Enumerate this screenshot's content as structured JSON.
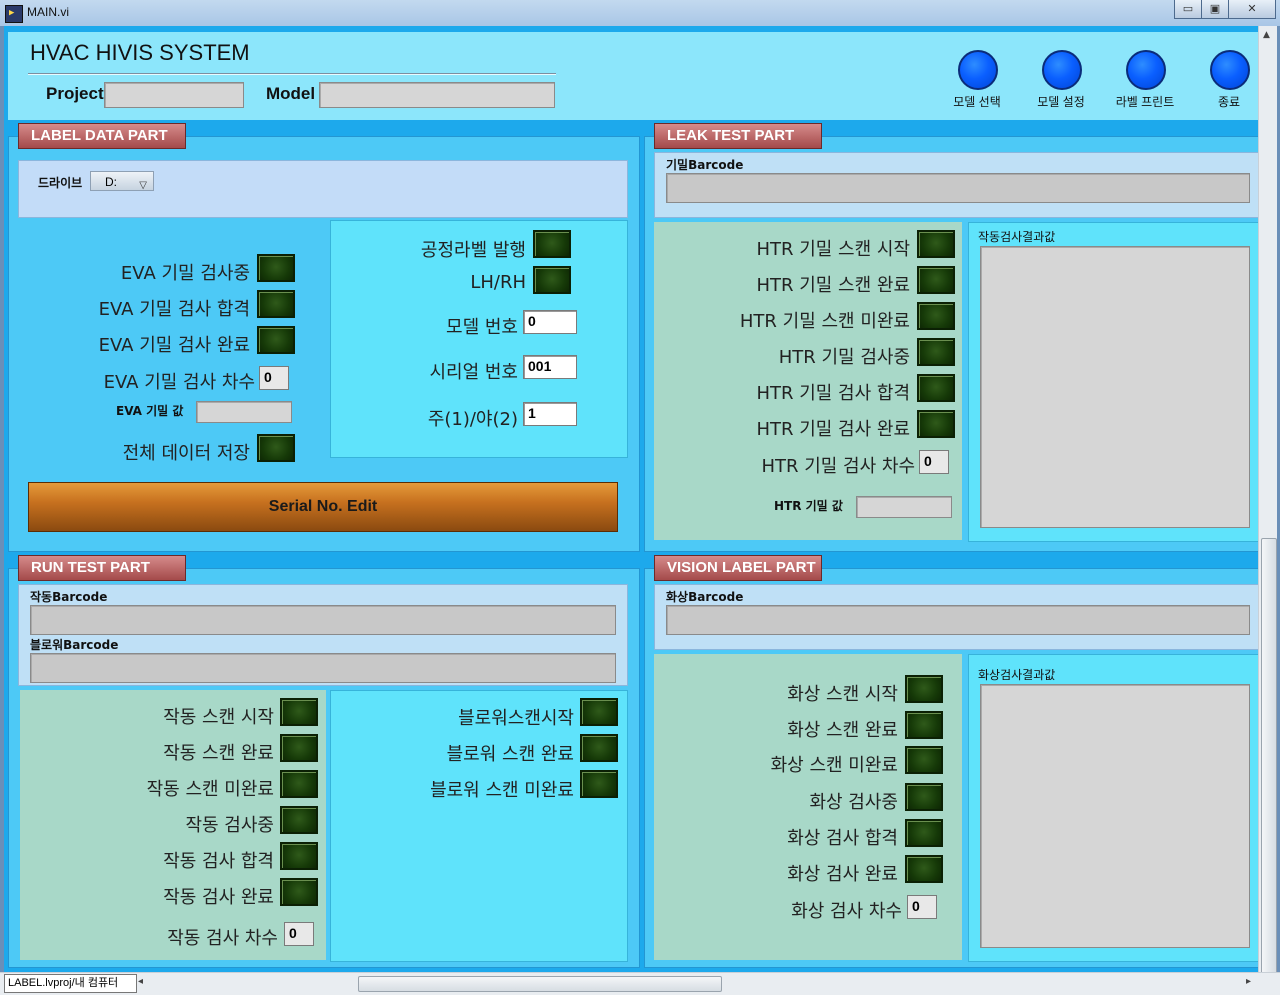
{
  "window": {
    "title": "MAIN.vi",
    "controls": {
      "minimize": "▭",
      "restore": "▣",
      "close": "✕"
    }
  },
  "header": {
    "system_name": "HVAC HIVIS SYSTEM",
    "project_label": "Project",
    "project_value": "",
    "model_label": "Model",
    "model_value": "",
    "buttons": [
      {
        "label": "모델 선택"
      },
      {
        "label": "모델 설정"
      },
      {
        "label": "라벨 프린트"
      },
      {
        "label": "종료"
      }
    ]
  },
  "label_data": {
    "tab": "LABEL DATA PART",
    "drive_label": "드라이브",
    "drive_value": "D:",
    "left_indicators": [
      {
        "label": "EVA 기밀 검사중"
      },
      {
        "label": "EVA 기밀 검사 합격"
      },
      {
        "label": "EVA 기밀 검사 완료"
      }
    ],
    "eva_count_label": "EVA 기밀 검사 차수",
    "eva_count_value": "0",
    "eva_value_label": "EVA 기밀 값",
    "eva_value": "",
    "save_all_label": "전체 데이터 저장",
    "right": {
      "process_label": "공정라벨 발행",
      "lhrh_label": "LH/RH",
      "model_no_label": "모델 번호",
      "model_no_value": "0",
      "serial_no_label": "시리얼 번호",
      "serial_no_value": "001",
      "daynight_label": "주(1)/야(2)",
      "daynight_value": "1"
    },
    "serial_edit_button": "Serial No. Edit"
  },
  "leak_test": {
    "tab": "LEAK TEST PART",
    "barcode_label": "기밀Barcode",
    "barcode_value": "",
    "indicators": [
      {
        "label": "HTR 기밀 스캔 시작"
      },
      {
        "label": "HTR 기밀 스캔 완료"
      },
      {
        "label": "HTR 기밀 스캔 미완료"
      },
      {
        "label": "HTR 기밀 검사중"
      },
      {
        "label": "HTR 기밀 검사 합격"
      },
      {
        "label": "HTR 기밀 검사 완료"
      }
    ],
    "count_label": "HTR 기밀 검사 차수",
    "count_value": "0",
    "value_label": "HTR 기밀 값",
    "value": "",
    "result_label": "작동검사결과값"
  },
  "run_test": {
    "tab": "RUN TEST PART",
    "run_barcode_label": "작동Barcode",
    "run_barcode_value": "",
    "blower_barcode_label": "블로워Barcode",
    "blower_barcode_value": "",
    "indicators": [
      {
        "label": "작동 스캔 시작"
      },
      {
        "label": "작동 스캔 완료"
      },
      {
        "label": "작동 스캔 미완료"
      },
      {
        "label": "작동 검사중"
      },
      {
        "label": "작동 검사 합격"
      },
      {
        "label": "작동 검사 완료"
      }
    ],
    "count_label": "작동 검사 차수",
    "count_value": "0",
    "blower_indicators": [
      {
        "label": "블로워스캔시작"
      },
      {
        "label": "블로워 스캔 완료"
      },
      {
        "label": "블로워 스캔 미완료"
      }
    ]
  },
  "vision_label": {
    "tab": "VISION LABEL PART",
    "barcode_label": "화상Barcode",
    "barcode_value": "",
    "indicators": [
      {
        "label": "화상 스캔 시작"
      },
      {
        "label": "화상 스캔 완료"
      },
      {
        "label": "화상 스캔 미완료"
      },
      {
        "label": "화상 검사중"
      },
      {
        "label": "화상 검사 합격"
      },
      {
        "label": "화상 검사 완료"
      }
    ],
    "count_label": "화상 검사 차수",
    "count_value": "0",
    "result_label": "화상검사결과값"
  },
  "status_bar": {
    "project_path": "LABEL.lvproj/내 컴퓨터"
  },
  "colors": {
    "panel_bg": "#1da9ec",
    "frame": "#4dc9f6",
    "tab_bg": "#a44a4a",
    "led_off": "#163a08",
    "button_blue": "#0a5fff"
  }
}
